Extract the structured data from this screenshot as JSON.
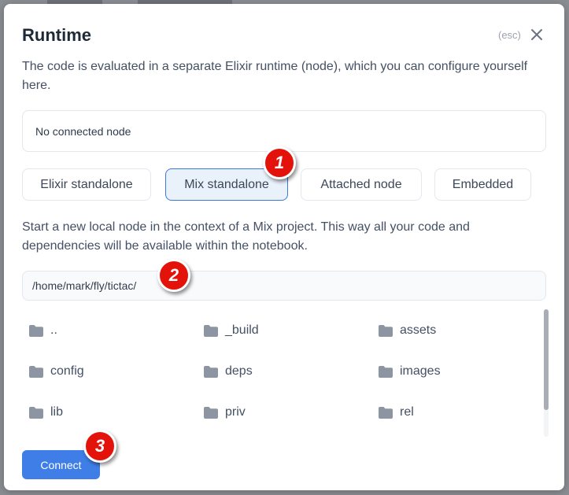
{
  "dialog": {
    "title": "Runtime",
    "esc_hint": "(esc)",
    "description": "The code is evaluated in a separate Elixir runtime (node), which you can configure yourself here."
  },
  "status": {
    "text": "No connected node"
  },
  "tabs": [
    {
      "label": "Elixir standalone",
      "active": false
    },
    {
      "label": "Mix standalone",
      "active": true
    },
    {
      "label": "Attached node",
      "active": false
    },
    {
      "label": "Embedded",
      "active": false
    }
  ],
  "mix": {
    "description": "Start a new local node in the context of a Mix project. This way all your code and dependencies will be available within the notebook.",
    "path_value": "/home/mark/fly/tictac/"
  },
  "files": [
    {
      "name": ".."
    },
    {
      "name": "_build"
    },
    {
      "name": "assets"
    },
    {
      "name": "config"
    },
    {
      "name": "deps"
    },
    {
      "name": "images"
    },
    {
      "name": "lib"
    },
    {
      "name": "priv"
    },
    {
      "name": "rel"
    }
  ],
  "actions": {
    "connect_label": "Connect"
  },
  "annotations": [
    "1",
    "2",
    "3"
  ],
  "icons": {
    "folder": "folder-icon",
    "close": "close-icon"
  },
  "colors": {
    "primary": "#3e7ee6",
    "badge": "#e3120b",
    "active_tab_border": "#3a79d6"
  }
}
